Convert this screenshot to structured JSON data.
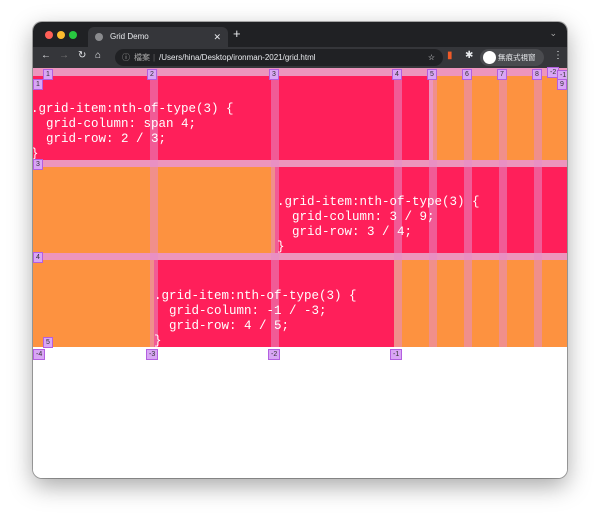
{
  "browser": {
    "tab_title": "Grid Demo",
    "url_prefix": "檔案",
    "url": "/Users/hina/Desktop/ironman-2021/grid.html",
    "profile_label": "無痕式視窗"
  },
  "colors": {
    "pink": "#ff1f5a",
    "orange": "#fd9240",
    "overlay": "#d9a6f5"
  },
  "grid": {
    "item_a": {
      "lines": [
        ".grid-item:nth-of-type(3) {",
        "  grid-column: span 4;",
        "  grid-row: 2 / 3;",
        "}"
      ]
    },
    "item_b": {
      "lines": [
        ".grid-item:nth-of-type(3) {",
        "  grid-column: 3 / 9;",
        "  grid-row: 3 / 4;",
        "}"
      ]
    },
    "item_c": {
      "lines": [
        ".grid-item:nth-of-type(3) {",
        "  grid-column: -1 / -3;",
        "  grid-row: 4 / 5;",
        "}"
      ]
    },
    "column_labels": [
      "1",
      "2",
      "3",
      "4",
      "5",
      "6",
      "7",
      "8",
      "-2",
      "-1",
      "9"
    ],
    "row_labels": [
      "1",
      "3",
      "4",
      "5"
    ],
    "bottom_labels": [
      "-4",
      "-3",
      "-2",
      "-1"
    ]
  }
}
